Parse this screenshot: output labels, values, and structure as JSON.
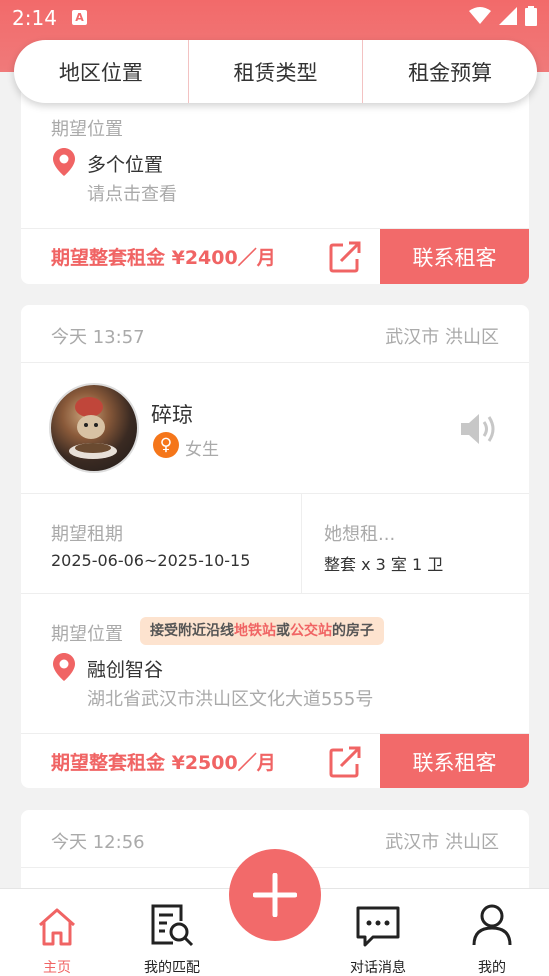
{
  "status_bar": {
    "time": "2:14",
    "notification_icon": "A"
  },
  "filters": [
    {
      "label": "地区位置"
    },
    {
      "label": "租赁类型"
    },
    {
      "label": "租金预算"
    }
  ],
  "card1": {
    "location_label": "期望位置",
    "location_name": "多个位置",
    "location_hint": "请点击查看",
    "rent_text": "期望整套租金 ¥2400／月",
    "contact_label": "联系租客"
  },
  "card2": {
    "date": "今天 13:57",
    "area": "武汉市 洪山区",
    "user_name": "碎琼",
    "gender_symbol": "♀",
    "gender": "女生",
    "period_label": "期望租期",
    "period_value": "2025-06-06~2025-10-15",
    "type_label": "她想租...",
    "type_value": "整套 x 3 室 1 卫",
    "location_label": "期望位置",
    "badge": {
      "prefix": "接受附近沿线",
      "subway": "地铁站",
      "or": "或",
      "bus": "公交站",
      "suffix": "的房子"
    },
    "location_name": "融创智谷",
    "location_address": "湖北省武汉市洪山区文化大道555号",
    "rent_text": "期望整套租金 ¥2500／月",
    "contact_label": "联系租客"
  },
  "card3": {
    "date": "今天 12:56",
    "area": "武汉市 洪山区"
  },
  "tabbar": {
    "home": "主页",
    "match": "我的匹配",
    "messages": "对话消息",
    "mine": "我的"
  },
  "colors": {
    "accent": "#f26a6a",
    "badge_bg": "#fde3cf"
  }
}
